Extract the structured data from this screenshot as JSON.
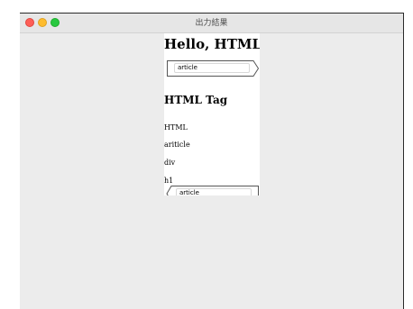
{
  "window": {
    "title": "出力結果"
  },
  "content": {
    "heading": "Hello, HTML!!",
    "tag_top": "article",
    "subheading": "HTML Tag",
    "items": [
      "HTML",
      "ariticle",
      "div",
      "h1"
    ],
    "tag_bottom": "article"
  }
}
